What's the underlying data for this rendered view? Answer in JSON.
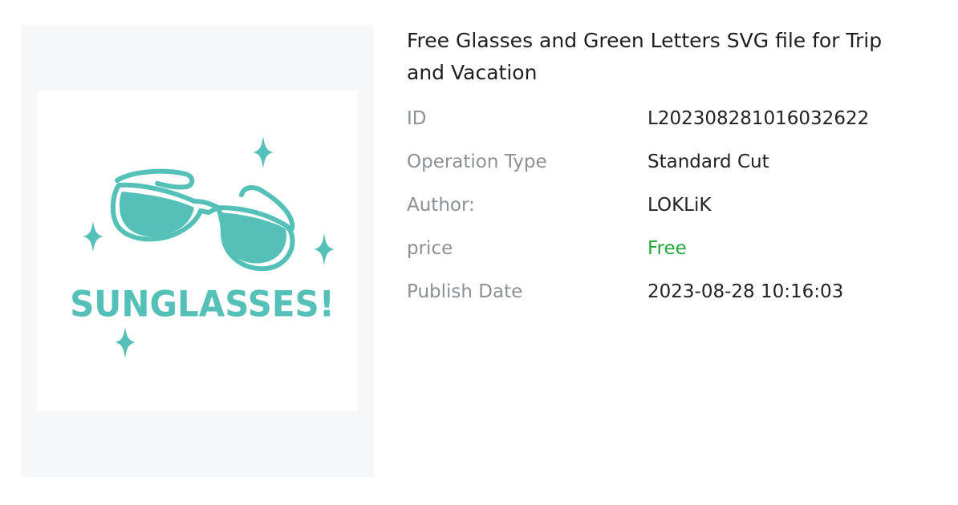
{
  "product": {
    "title": "Free Glasses and Green Letters SVG file  for Trip and Vacation",
    "image": {
      "icon": "sunglasses-illustration",
      "text": "SUNGLASSES!",
      "color": "#55c0b7"
    }
  },
  "details": [
    {
      "label": "ID",
      "value": "L202308281016032622"
    },
    {
      "label": "Operation Type",
      "value": "Standard Cut"
    },
    {
      "label": "Author:",
      "value": "LOKLiK"
    },
    {
      "label": "price",
      "value": "Free",
      "color": "#22a83a"
    },
    {
      "label": "Publish Date",
      "value": "2023-08-28 10:16:03"
    }
  ]
}
